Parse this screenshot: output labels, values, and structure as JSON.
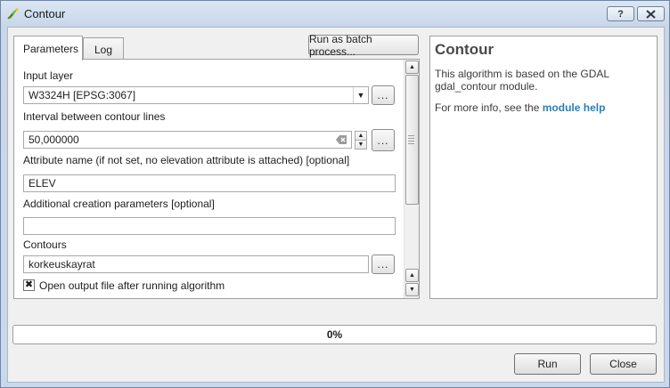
{
  "window": {
    "title": "Contour",
    "help_btn": "?"
  },
  "tabs": [
    {
      "label": "Parameters",
      "active": true
    },
    {
      "label": "Log",
      "active": false
    }
  ],
  "batch_button": "Run as batch process...",
  "params": {
    "input_layer": {
      "label": "Input layer",
      "value": "W3324H [EPSG:3067]"
    },
    "interval": {
      "label": "Interval between contour lines",
      "value": "50,000000"
    },
    "attribute": {
      "label": "Attribute name (if not set, no elevation attribute is attached) [optional]",
      "value": "ELEV"
    },
    "creation": {
      "label": "Additional creation parameters [optional]",
      "value": ""
    },
    "contours": {
      "label": "Contours",
      "value": "korkeuskayrat"
    },
    "open_output": {
      "label": "Open output file after running algorithm",
      "checked": true
    }
  },
  "dots": "...",
  "help": {
    "title": "Contour",
    "description": "This algorithm is based on the GDAL gdal_contour module.",
    "more_prefix": "For more info, see the",
    "link": "module help"
  },
  "progress": {
    "value": 0,
    "text": "0%"
  },
  "buttons": {
    "run": "Run",
    "close": "Close"
  },
  "icons": {
    "app": "qgis-icon",
    "clear": "clear-text-icon",
    "close": "close-icon"
  },
  "colors": {
    "link": "#2f7fb5",
    "progress_fill": "#26a0da"
  }
}
